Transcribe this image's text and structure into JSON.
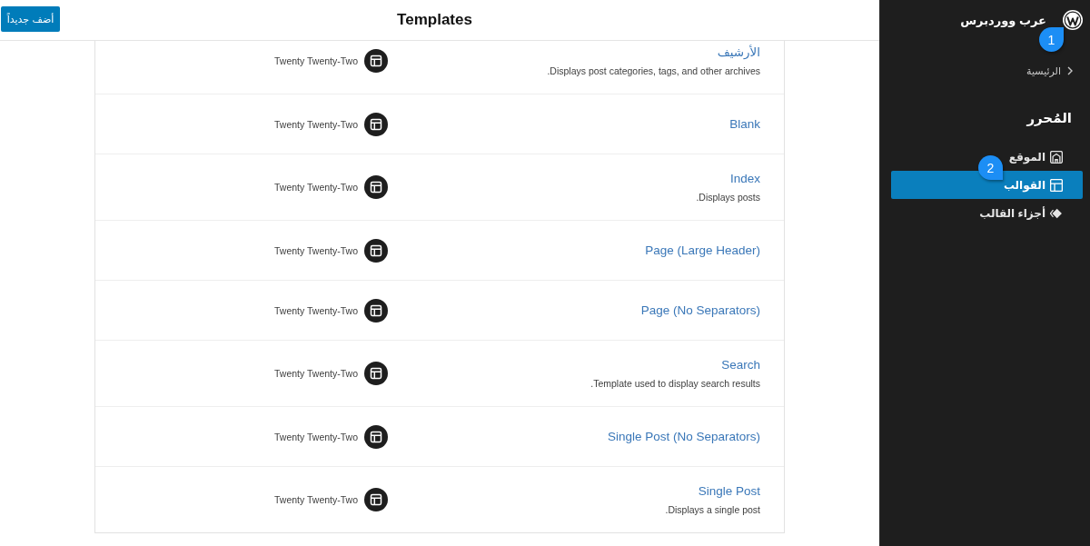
{
  "header": {
    "add_button": "أضف جديداً",
    "title": "Templates"
  },
  "templates": [
    {
      "title": "الأرشيف",
      "description": "Displays post categories, tags, and other archives.",
      "theme": "Twenty Twenty-Two"
    },
    {
      "title": "Blank",
      "theme": "Twenty Twenty-Two"
    },
    {
      "title": "Index",
      "description": "Displays posts.",
      "theme": "Twenty Twenty-Two"
    },
    {
      "title": "Page (Large Header)",
      "theme": "Twenty Twenty-Two"
    },
    {
      "title": "Page (No Separators)",
      "theme": "Twenty Twenty-Two"
    },
    {
      "title": "Search",
      "description": "Template used to display search results.",
      "theme": "Twenty Twenty-Two"
    },
    {
      "title": "Single Post (No Separators)",
      "theme": "Twenty Twenty-Two"
    },
    {
      "title": "Single Post",
      "description": "Displays a single post.",
      "theme": "Twenty Twenty-Two"
    }
  ],
  "sidebar": {
    "site_name": "عرب ووردبرس",
    "callout": "1",
    "back_link": "الرئيسية",
    "heading": "المُحرر",
    "items": [
      {
        "label": "الموقع",
        "kind": "home",
        "selected": false
      },
      {
        "label": "القوالب",
        "kind": "layout",
        "selected": true,
        "callout": "2"
      },
      {
        "label": "أجزاء القالب",
        "kind": "diamond",
        "selected": false
      }
    ]
  }
}
